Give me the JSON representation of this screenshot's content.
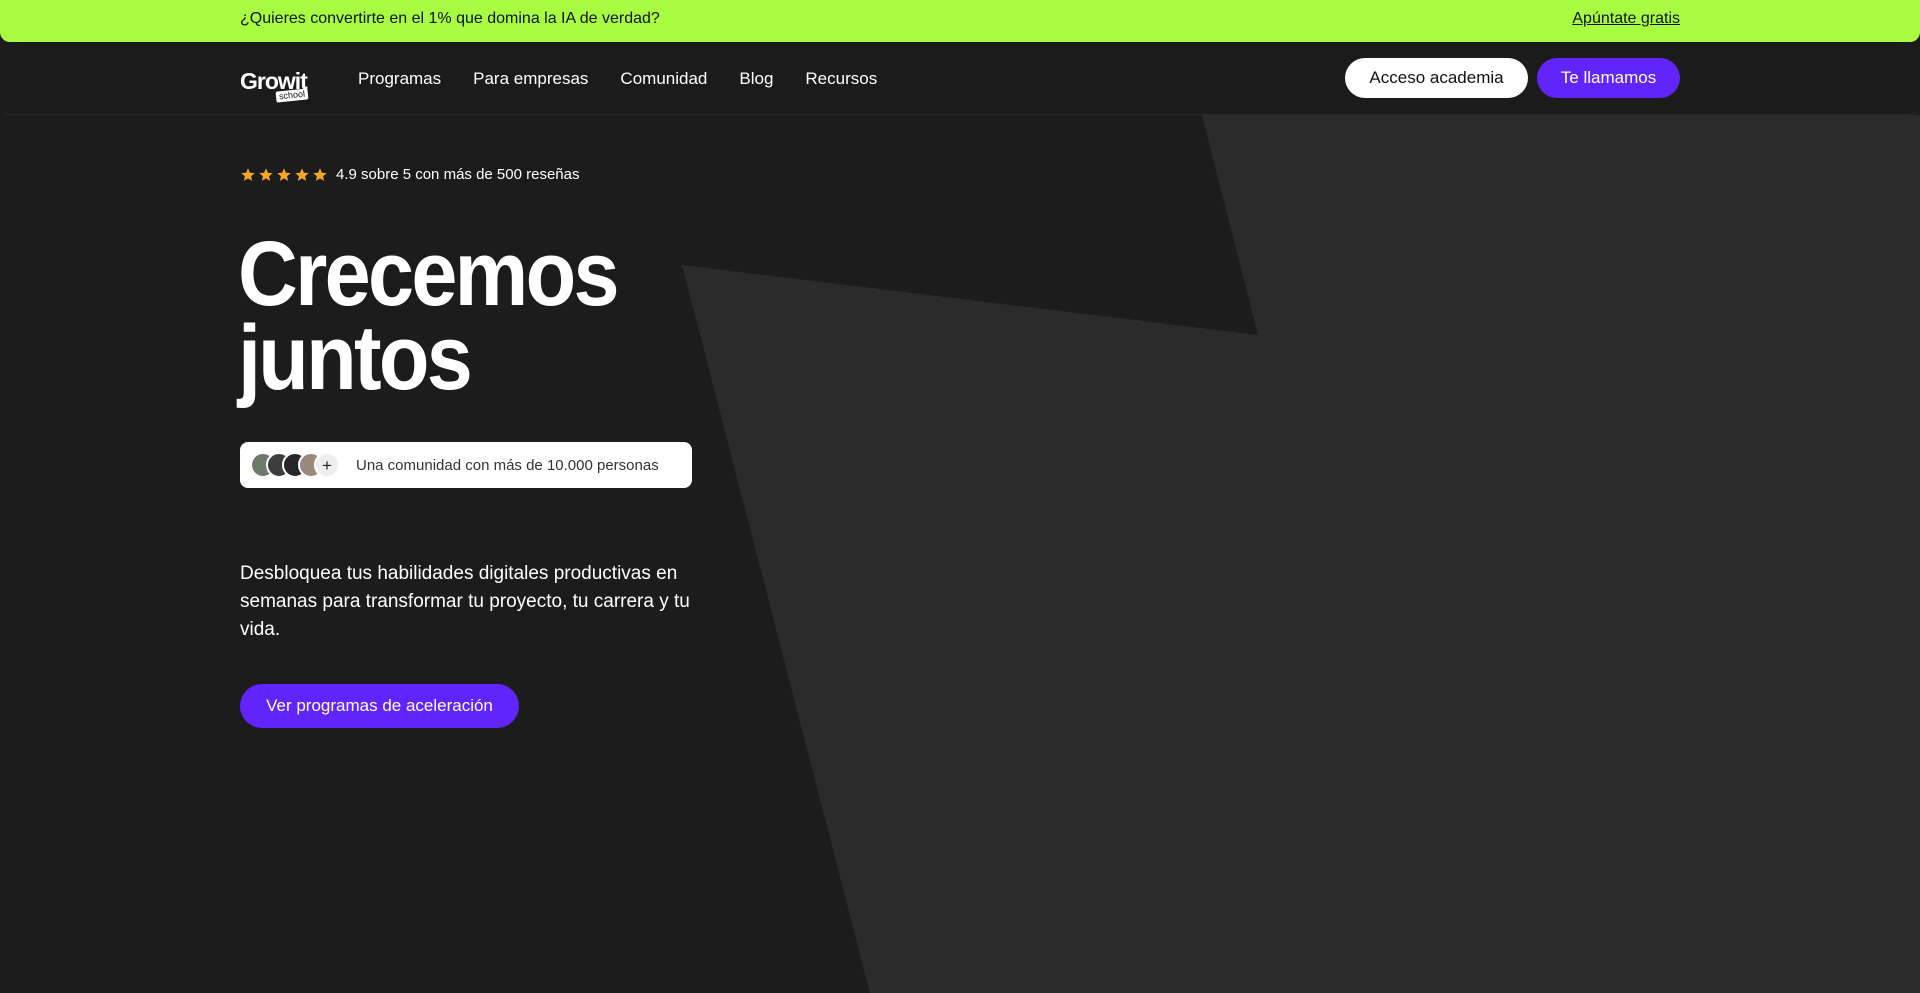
{
  "announcement": {
    "text": "¿Quieres convertirte en el 1% que domina la IA de verdad?",
    "link_label": "Apúntate gratis"
  },
  "header": {
    "logo_text": "Growit",
    "logo_badge": "school",
    "nav": [
      {
        "label": "Programas"
      },
      {
        "label": "Para empresas"
      },
      {
        "label": "Comunidad"
      },
      {
        "label": "Blog"
      },
      {
        "label": "Recursos"
      }
    ],
    "access_label": "Acceso academia",
    "call_label": "Te llamamos"
  },
  "hero": {
    "rating_stars": 5,
    "rating_text": "4.9 sobre 5 con más de 500 reseñas",
    "title_line1": "Crecemos",
    "title_line2": "juntos",
    "community_plus": "+",
    "community_text": "Una comunidad con más de 10.000 personas",
    "description": "Desbloquea tus habilidades digitales productivas en semanas para transformar tu proyecto, tu carrera y tu vida.",
    "cta_label": "Ver programas de aceleración"
  },
  "colors": {
    "accent_green": "#a8fd43",
    "brand_purple": "#6124fa",
    "background": "#1c1c1c",
    "shape": "#2b2b2b",
    "star": "#f6a623"
  },
  "icons": {
    "rating": "star-icon",
    "community_more": "plus-icon"
  }
}
